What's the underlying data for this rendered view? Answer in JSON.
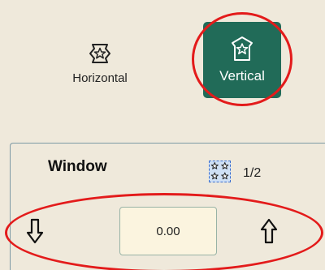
{
  "orientation": {
    "horizontal": {
      "label": "Horizontal",
      "icon": "horizontal-star-icon",
      "selected": false
    },
    "vertical": {
      "label": "Vertical",
      "icon": "vertical-star-icon",
      "selected": true
    }
  },
  "window_panel": {
    "title": "Window",
    "pages_icon": "star-grid-icon",
    "page_counter": "1/2",
    "decrease_icon": "arrow-down-icon",
    "increase_icon": "arrow-up-icon",
    "value": "0.00"
  },
  "colors": {
    "background": "#efe9db",
    "selected_button": "#216b58",
    "annotation_red": "#e31b1b",
    "panel_border": "#7d9aa5",
    "value_box_bg": "#fbf4df"
  }
}
